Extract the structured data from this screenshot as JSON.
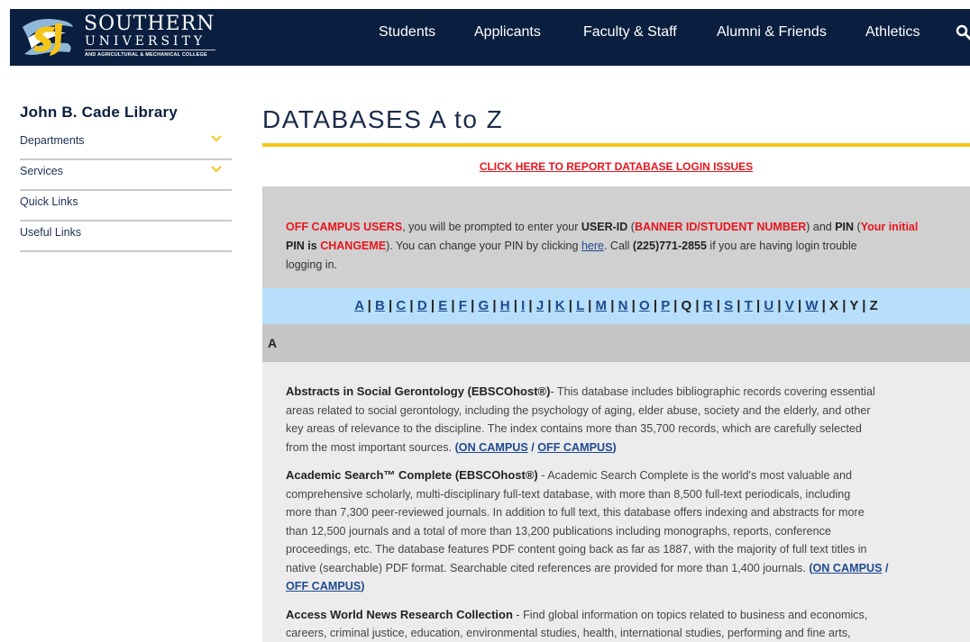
{
  "header": {
    "logo": {
      "word": "SOUTHERN",
      "sub1": "UNIVERSITY",
      "sub2": "AND AGRICULTURAL & MECHANICAL COLLEGE"
    },
    "nav": [
      {
        "label": "Students"
      },
      {
        "label": "Applicants"
      },
      {
        "label": "Faculty & Staff"
      },
      {
        "label": "Alumni & Friends"
      },
      {
        "label": "Athletics"
      }
    ],
    "search_icon": "search-icon"
  },
  "sidebar": {
    "title": "John B. Cade Library",
    "items": [
      {
        "label": "Departments",
        "has_dropdown": true
      },
      {
        "label": "Services",
        "has_dropdown": true
      },
      {
        "label": "Quick Links",
        "has_dropdown": false
      },
      {
        "label": "Useful Links",
        "has_dropdown": false
      }
    ]
  },
  "main": {
    "title": "DATABASES A to Z",
    "report_link": "CLICK HERE TO REPORT DATABASE LOGIN ISSUES",
    "notice": {
      "off_campus": "OFF CAMPUS USERS",
      "t1": ", you will be prompted to enter your ",
      "user_id": "USER-ID",
      "t2": " (",
      "banner": "BANNER ID/STUDENT NUMBER",
      "t3": ") and ",
      "pin": "PIN",
      "t4": " (",
      "your_initial": "Your initial",
      "pin_is": "PIN is ",
      "changeme": "CHANGEME",
      "t5": "). You can change your PIN by clicking ",
      "here": "here",
      "t6": ". Call ",
      "phone": "(225)771-2855",
      "t7": " if you are having login trouble",
      "t8": "logging in."
    },
    "alphabet": [
      "A",
      "B",
      "C",
      "D",
      "E",
      "F",
      "G",
      "H",
      "I",
      "J",
      "K",
      "L",
      "M",
      "N",
      "O",
      "P",
      "Q",
      "R",
      "S",
      "T",
      "U",
      "V",
      "W",
      "X",
      "Y",
      "Z"
    ],
    "alphabet_linked": [
      "A",
      "B",
      "C",
      "D",
      "E",
      "F",
      "G",
      "H",
      "I",
      "J",
      "K",
      "L",
      "M",
      "N",
      "O",
      "P",
      "R",
      "S",
      "T",
      "U",
      "V",
      "W"
    ],
    "section_letter": "A",
    "entries": [
      {
        "name": "Abstracts in Social Gerontology (EBSCOhost®)",
        "lines": [
          "- This database includes bibliographic records covering essential",
          "areas related to social gerontology, including the psychology of aging, elder abuse, society and the elderly, and other",
          "key areas of relevance to the discipline. The index contains more than 35,700 records, which are carefully selected",
          "from the most important sources. "
        ],
        "on_campus": "ON CAMPUS",
        "off_campus": "OFF CAMPUS"
      },
      {
        "name": "Academic Search™ Complete (EBSCOhost®)",
        "lines": [
          " - Academic Search Complete is the world's most valuable and",
          "comprehensive scholarly, multi-disciplinary full-text database, with more than 8,500 full-text periodicals, including",
          "more than 7,300 peer-reviewed journals. In addition to full text, this database offers indexing and abstracts for more",
          "than 12,500 journals and a total of more than 13,200 publications including monographs, reports, conference",
          "proceedings, etc. The database features PDF content going back as far as 1887, with the majority of full text titles in",
          "native (searchable) PDF format. Searchable cited references are provided for more than 1,400 journals. "
        ],
        "on_campus": "ON CAMPUS",
        "off_campus": "OFF CAMPUS"
      },
      {
        "name": "Access World News Research Collection",
        "lines": [
          " - Find global information on topics related to business and economics,",
          "careers, criminal justice, education, environmental studies, health, international studies, performing and fine arts,"
        ]
      }
    ]
  }
}
